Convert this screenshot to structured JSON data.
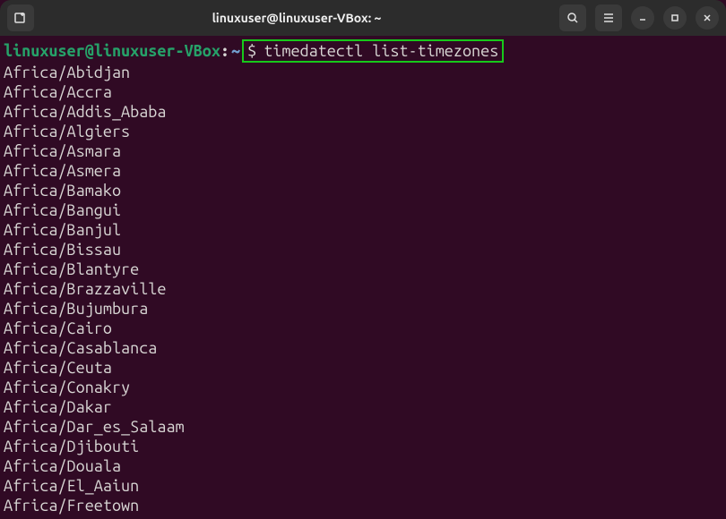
{
  "titlebar": {
    "title": "linuxuser@linuxuser-VBox: ~"
  },
  "prompt": {
    "userhost": "linuxuser@linuxuser-VBox",
    "separator": ":",
    "path": "~",
    "dollar": "$",
    "command": "timedatectl list-timezones"
  },
  "output": [
    "Africa/Abidjan",
    "Africa/Accra",
    "Africa/Addis_Ababa",
    "Africa/Algiers",
    "Africa/Asmara",
    "Africa/Asmera",
    "Africa/Bamako",
    "Africa/Bangui",
    "Africa/Banjul",
    "Africa/Bissau",
    "Africa/Blantyre",
    "Africa/Brazzaville",
    "Africa/Bujumbura",
    "Africa/Cairo",
    "Africa/Casablanca",
    "Africa/Ceuta",
    "Africa/Conakry",
    "Africa/Dakar",
    "Africa/Dar_es_Salaam",
    "Africa/Djibouti",
    "Africa/Douala",
    "Africa/El_Aaiun",
    "Africa/Freetown"
  ]
}
